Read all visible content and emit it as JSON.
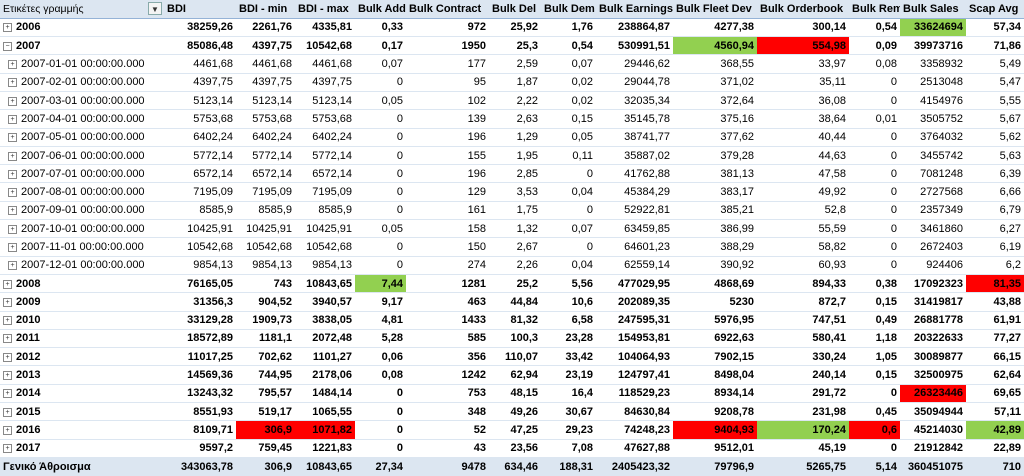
{
  "columns": [
    "Ετικέτες γραμμής",
    "BDI",
    "BDI - min",
    "BDI - max",
    "Bulk Add",
    "Bulk Contract",
    "Bulk Del",
    "Bulk Dem",
    "Bulk Earnings",
    "Bulk Fleet Dev",
    "Bulk Orderbook",
    "Bulk Rem",
    "Bulk Sales",
    "Scap Avg"
  ],
  "rows": [
    {
      "type": "year",
      "expander": "+",
      "label": "2006",
      "cells": [
        "38259,26",
        "2261,76",
        "4335,81",
        "0,33",
        "972",
        "25,92",
        "1,76",
        "238864,87",
        "4277,38",
        "300,14",
        "0,54",
        "33624694",
        "57,34"
      ]
    },
    {
      "type": "year",
      "expander": "−",
      "label": "2007",
      "cells": [
        "85086,48",
        "4397,75",
        "10542,68",
        "0,17",
        "1950",
        "25,3",
        "0,54",
        "530991,51",
        "4560,94",
        "554,98",
        "0,09",
        "39973716",
        "71,86"
      ]
    },
    {
      "type": "month",
      "expander": "+",
      "label": "2007-01-01 00:00:00.000",
      "cells": [
        "4461,68",
        "4461,68",
        "4461,68",
        "0,07",
        "177",
        "2,59",
        "0,07",
        "29446,62",
        "368,55",
        "33,97",
        "0,08",
        "3358932",
        "5,49"
      ]
    },
    {
      "type": "month",
      "expander": "+",
      "label": "2007-02-01 00:00:00.000",
      "cells": [
        "4397,75",
        "4397,75",
        "4397,75",
        "0",
        "95",
        "1,87",
        "0,02",
        "29044,78",
        "371,02",
        "35,11",
        "0",
        "2513048",
        "5,47"
      ]
    },
    {
      "type": "month",
      "expander": "+",
      "label": "2007-03-01 00:00:00.000",
      "cells": [
        "5123,14",
        "5123,14",
        "5123,14",
        "0,05",
        "102",
        "2,22",
        "0,02",
        "32035,34",
        "372,64",
        "36,08",
        "0",
        "4154976",
        "5,55"
      ]
    },
    {
      "type": "month",
      "expander": "+",
      "label": "2007-04-01 00:00:00.000",
      "cells": [
        "5753,68",
        "5753,68",
        "5753,68",
        "0",
        "139",
        "2,63",
        "0,15",
        "35145,78",
        "375,16",
        "38,64",
        "0,01",
        "3505752",
        "5,67"
      ]
    },
    {
      "type": "month",
      "expander": "+",
      "label": "2007-05-01 00:00:00.000",
      "cells": [
        "6402,24",
        "6402,24",
        "6402,24",
        "0",
        "196",
        "1,29",
        "0,05",
        "38741,77",
        "377,62",
        "40,44",
        "0",
        "3764032",
        "5,62"
      ]
    },
    {
      "type": "month",
      "expander": "+",
      "label": "2007-06-01 00:00:00.000",
      "cells": [
        "5772,14",
        "5772,14",
        "5772,14",
        "0",
        "155",
        "1,95",
        "0,11",
        "35887,02",
        "379,28",
        "44,63",
        "0",
        "3455742",
        "5,63"
      ]
    },
    {
      "type": "month",
      "expander": "+",
      "label": "2007-07-01 00:00:00.000",
      "cells": [
        "6572,14",
        "6572,14",
        "6572,14",
        "0",
        "196",
        "2,85",
        "0",
        "41762,88",
        "381,13",
        "47,58",
        "0",
        "7081248",
        "6,39"
      ]
    },
    {
      "type": "month",
      "expander": "+",
      "label": "2007-08-01 00:00:00.000",
      "cells": [
        "7195,09",
        "7195,09",
        "7195,09",
        "0",
        "129",
        "3,53",
        "0,04",
        "45384,29",
        "383,17",
        "49,92",
        "0",
        "2727568",
        "6,66"
      ]
    },
    {
      "type": "month",
      "expander": "+",
      "label": "2007-09-01 00:00:00.000",
      "cells": [
        "8585,9",
        "8585,9",
        "8585,9",
        "0",
        "161",
        "1,75",
        "0",
        "52922,81",
        "385,21",
        "52,8",
        "0",
        "2357349",
        "6,79"
      ]
    },
    {
      "type": "month",
      "expander": "+",
      "label": "2007-10-01 00:00:00.000",
      "cells": [
        "10425,91",
        "10425,91",
        "10425,91",
        "0,05",
        "158",
        "1,32",
        "0,07",
        "63459,85",
        "386,99",
        "55,59",
        "0",
        "3461860",
        "6,27"
      ]
    },
    {
      "type": "month",
      "expander": "+",
      "label": "2007-11-01 00:00:00.000",
      "cells": [
        "10542,68",
        "10542,68",
        "10542,68",
        "0",
        "150",
        "2,67",
        "0",
        "64601,23",
        "388,29",
        "58,82",
        "0",
        "2672403",
        "6,19"
      ]
    },
    {
      "type": "month",
      "expander": "+",
      "label": "2007-12-01 00:00:00.000",
      "cells": [
        "9854,13",
        "9854,13",
        "9854,13",
        "0",
        "274",
        "2,26",
        "0,04",
        "62559,14",
        "390,92",
        "60,93",
        "0",
        "924406",
        "6,2"
      ]
    },
    {
      "type": "year",
      "expander": "+",
      "label": "2008",
      "cells": [
        "76165,05",
        "743",
        "10843,65",
        "7,44",
        "1281",
        "25,2",
        "5,56",
        "477029,95",
        "4868,69",
        "894,33",
        "0,38",
        "17092323",
        "81,35"
      ]
    },
    {
      "type": "year",
      "expander": "+",
      "label": "2009",
      "cells": [
        "31356,3",
        "904,52",
        "3940,57",
        "9,17",
        "463",
        "44,84",
        "10,6",
        "202089,35",
        "5230",
        "872,7",
        "0,15",
        "31419817",
        "43,88"
      ]
    },
    {
      "type": "year",
      "expander": "+",
      "label": "2010",
      "cells": [
        "33129,28",
        "1909,73",
        "3838,05",
        "4,81",
        "1433",
        "81,32",
        "6,58",
        "247595,31",
        "5976,95",
        "747,51",
        "0,49",
        "26881778",
        "61,91"
      ]
    },
    {
      "type": "year",
      "expander": "+",
      "label": "2011",
      "cells": [
        "18572,89",
        "1181,1",
        "2072,48",
        "5,28",
        "585",
        "100,3",
        "23,28",
        "154953,81",
        "6922,63",
        "580,41",
        "1,18",
        "20322633",
        "77,27"
      ]
    },
    {
      "type": "year",
      "expander": "+",
      "label": "2012",
      "cells": [
        "11017,25",
        "702,62",
        "1101,27",
        "0,06",
        "356",
        "110,07",
        "33,42",
        "104064,93",
        "7902,15",
        "330,24",
        "1,05",
        "30089877",
        "66,15"
      ]
    },
    {
      "type": "year",
      "expander": "+",
      "label": "2013",
      "cells": [
        "14569,36",
        "744,95",
        "2178,06",
        "0,08",
        "1242",
        "62,94",
        "23,19",
        "124797,41",
        "8498,04",
        "240,14",
        "0,15",
        "32500975",
        "62,64"
      ]
    },
    {
      "type": "year",
      "expander": "+",
      "label": "2014",
      "cells": [
        "13243,32",
        "795,57",
        "1484,14",
        "0",
        "753",
        "48,15",
        "16,4",
        "118529,23",
        "8934,14",
        "291,72",
        "0",
        "26323446",
        "69,65"
      ]
    },
    {
      "type": "year",
      "expander": "+",
      "label": "2015",
      "cells": [
        "8551,93",
        "519,17",
        "1065,55",
        "0",
        "348",
        "49,26",
        "30,67",
        "84630,84",
        "9208,78",
        "231,98",
        "0,45",
        "35094944",
        "57,11"
      ]
    },
    {
      "type": "year",
      "expander": "+",
      "label": "2016",
      "cells": [
        "8109,71",
        "306,9",
        "1071,82",
        "0",
        "52",
        "47,25",
        "29,23",
        "74248,23",
        "9404,93",
        "170,24",
        "0,6",
        "45214030",
        "42,89"
      ]
    },
    {
      "type": "year",
      "expander": "+",
      "label": "2017",
      "cells": [
        "9597,2",
        "759,45",
        "1221,83",
        "0",
        "43",
        "23,56",
        "7,08",
        "47627,88",
        "9512,01",
        "45,19",
        "0",
        "21912842",
        "22,89"
      ]
    }
  ],
  "total": {
    "label": "Γενικό Άθροισμα",
    "cells": [
      "343063,78",
      "306,9",
      "10843,65",
      "27,34",
      "9478",
      "634,46",
      "188,31",
      "2405423,32",
      "79796,9",
      "5265,75",
      "5,14",
      "360451075",
      "710"
    ]
  },
  "highlights": [
    {
      "row": 0,
      "col": 11,
      "color": "green"
    },
    {
      "row": 1,
      "col": 8,
      "color": "green"
    },
    {
      "row": 1,
      "col": 9,
      "color": "red"
    },
    {
      "row": 14,
      "col": 3,
      "color": "green"
    },
    {
      "row": 14,
      "col": 12,
      "color": "red"
    },
    {
      "row": 14,
      "col": 13,
      "color": "green"
    },
    {
      "row": 20,
      "col": 11,
      "color": "red"
    },
    {
      "row": 22,
      "col": 1,
      "color": "red"
    },
    {
      "row": 22,
      "col": 2,
      "color": "red"
    },
    {
      "row": 22,
      "col": 8,
      "color": "red"
    },
    {
      "row": 22,
      "col": 9,
      "color": "green"
    },
    {
      "row": 22,
      "col": 10,
      "color": "red"
    },
    {
      "row": 22,
      "col": 12,
      "color": "green"
    },
    {
      "row": 22,
      "col": 13,
      "color": "red"
    }
  ],
  "colors": {
    "green": "#92d050",
    "red": "#ff0000",
    "header_bg": "#dce6f1"
  }
}
